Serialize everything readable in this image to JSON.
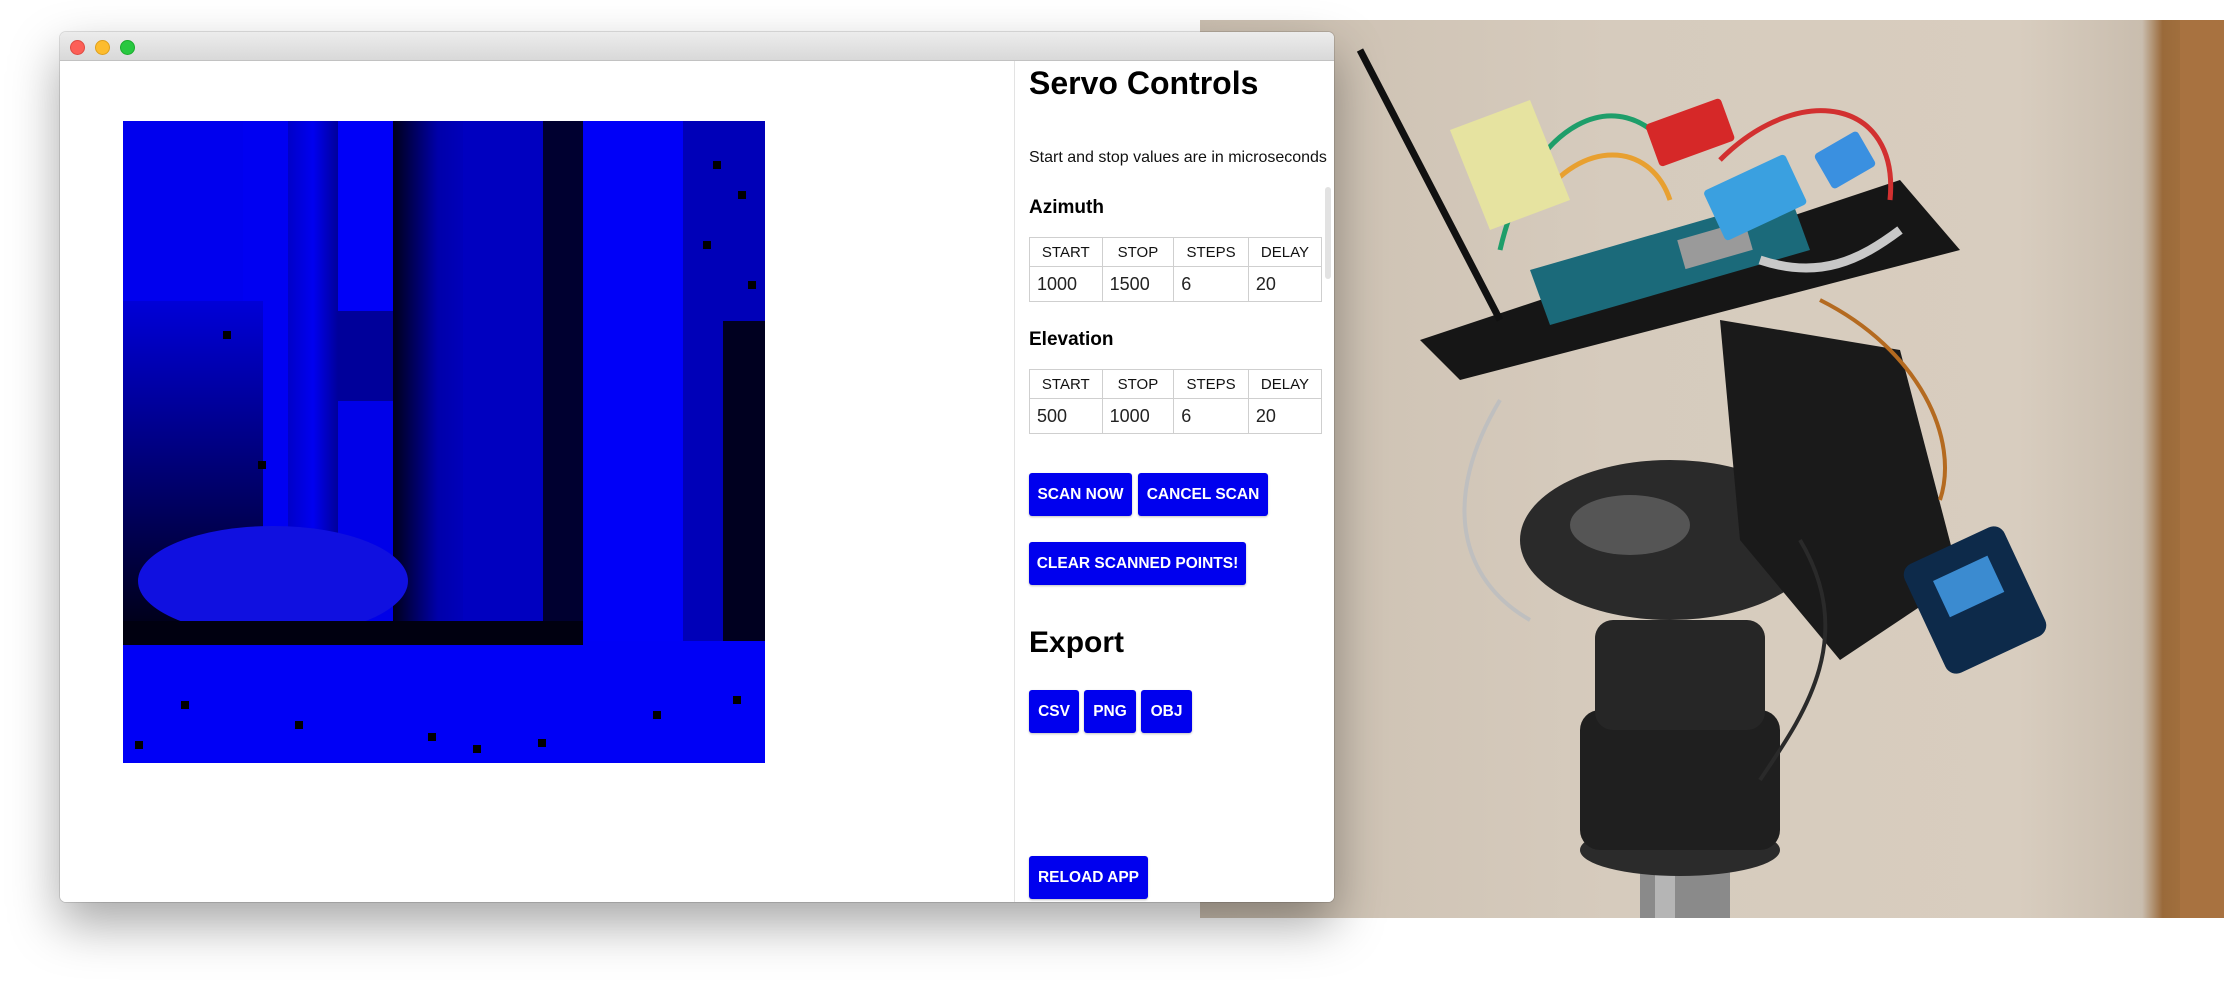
{
  "servo_panel": {
    "title": "Servo Controls",
    "note": "Start and stop values are in microseconds",
    "columns": [
      "START",
      "STOP",
      "STEPS",
      "DELAY"
    ],
    "azimuth": {
      "label": "Azimuth",
      "values": [
        "1000",
        "1500",
        "6",
        "20"
      ]
    },
    "elevation": {
      "label": "Elevation",
      "values": [
        "500",
        "1000",
        "6",
        "20"
      ]
    }
  },
  "actions": {
    "scan_now": "SCAN NOW",
    "cancel_scan": "CANCEL SCAN",
    "clear_points": "CLEAR SCANNED POINTS!"
  },
  "export": {
    "title": "Export",
    "csv": "CSV",
    "png": "PNG",
    "obj": "OBJ"
  },
  "reload": "RELOAD APP",
  "colors": {
    "button": "#0000ee",
    "scan_base": "#0000ff"
  },
  "icons": {
    "close": "close-icon",
    "minimize": "minimize-icon",
    "maximize": "maximize-icon"
  }
}
